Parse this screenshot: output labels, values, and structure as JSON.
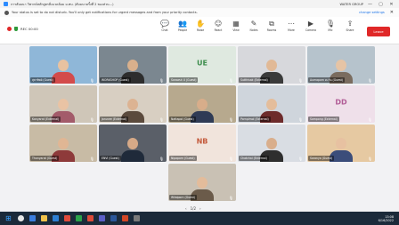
{
  "window": {
    "title": "การสัมมนา วิพากษ์หลักสูตรสิ่งแวดล้อม ม.ทบ. (สัมมนาครั้งที่ 2 ของส่วน...)",
    "account": "WATER GROUP",
    "controls": [
      "—",
      "▢",
      "✕"
    ]
  },
  "notice": {
    "text": "Your status is set to do not disturb. You'll only get notifications for urgent messages and from your priority contacts.",
    "link": "change settings",
    "close": "✕"
  },
  "toolbar": {
    "recording_label": "REC 00:00",
    "tools": [
      {
        "icon": "chat-icon",
        "label": "Chat"
      },
      {
        "icon": "people-icon",
        "label": "People"
      },
      {
        "icon": "raise-hand-icon",
        "label": "Raise"
      },
      {
        "icon": "react-icon",
        "label": "React"
      },
      {
        "icon": "view-icon",
        "label": "View"
      },
      {
        "icon": "notes-icon",
        "label": "Notes"
      },
      {
        "icon": "rooms-icon",
        "label": "Rooms"
      },
      {
        "icon": "more-icon",
        "label": "More"
      },
      {
        "icon": "camera-icon",
        "label": "Camera"
      },
      {
        "icon": "mic-icon",
        "label": "Mic"
      },
      {
        "icon": "share-icon",
        "label": "Share"
      }
    ],
    "leave_label": "Leave"
  },
  "participants": [
    {
      "name": "สุธาทิพย์ (Guest)",
      "kind": "video",
      "bg": "#8fb7d8",
      "skin": "#e8c2a0",
      "shirt": "#d34b4b"
    },
    {
      "name": "WORKSHOP (Guest)",
      "kind": "video",
      "bg": "#7b8790",
      "skin": "#d9b08c",
      "shirt": "#2d2d2d"
    },
    {
      "name": "Sarawut U (Guest)",
      "kind": "initials",
      "initials": "UE",
      "bg": "#dfe9e0",
      "fg": "#3d8d4d"
    },
    {
      "name": "Sutthisak (External)",
      "kind": "video",
      "bg": "#d7d8dc",
      "skin": "#e1b996",
      "shirt": "#3a3a3a"
    },
    {
      "name": "Aumaporn ตะวัน (Guest)",
      "kind": "video",
      "bg": "#b6c3cc",
      "skin": "#e6c4a5",
      "shirt": "#7a6c5f"
    },
    {
      "name": "Kanyarat (External)",
      "kind": "video",
      "bg": "#cfc6b8",
      "skin": "#e9c3a4",
      "shirt": "#a35b6a"
    },
    {
      "name": "Jarunee (External)",
      "kind": "video",
      "bg": "#d8cfc2",
      "skin": "#dcb392",
      "shirt": "#5b4a3c"
    },
    {
      "name": "Nattapol (Guest)",
      "kind": "video",
      "bg": "#b7a98e",
      "skin": "#d8ad8a",
      "shirt": "#2f3b55"
    },
    {
      "name": "Pornpimol (External)",
      "kind": "video",
      "bg": "#cfd5dc",
      "skin": "#e4bd9b",
      "shirt": "#6d2b2b"
    },
    {
      "name": "Sompong (External)",
      "kind": "initials",
      "initials": "DD",
      "bg": "#efe0ea",
      "fg": "#b15c96"
    },
    {
      "name": "Thanyarat (Guest)",
      "kind": "video",
      "bg": "#c8bba5",
      "skin": "#e0b694",
      "shirt": "#8e3a3a"
    },
    {
      "name": "ENVI (Guest)",
      "kind": "video",
      "bg": "#5a5f68",
      "skin": "#d6a987",
      "shirt": "#1f2a3a"
    },
    {
      "name": "Nipaporn (Guest)",
      "kind": "initials",
      "initials": "NB",
      "bg": "#f1e4dc",
      "fg": "#c45a3c"
    },
    {
      "name": "Chatchai (External)",
      "kind": "video",
      "bg": "#d9dde3",
      "skin": "#d9ae8c",
      "shirt": "#2e2e2e"
    },
    {
      "name": "Saranya (Guest)",
      "kind": "video",
      "bg": "#e6c9a2",
      "skin": "#e7c1a1",
      "shirt": "#3b4d7a"
    },
    {
      "name": "Wilaiporn (Guest)",
      "kind": "video",
      "bg": "#c9c1b4",
      "skin": "#e3bc9b",
      "shirt": "#6b5b4a"
    }
  ],
  "pager": {
    "prev": "‹",
    "label": "1/2",
    "next": "›"
  },
  "taskbar": {
    "start": "⊞",
    "time": "13:08",
    "date": "6/16/2022"
  }
}
